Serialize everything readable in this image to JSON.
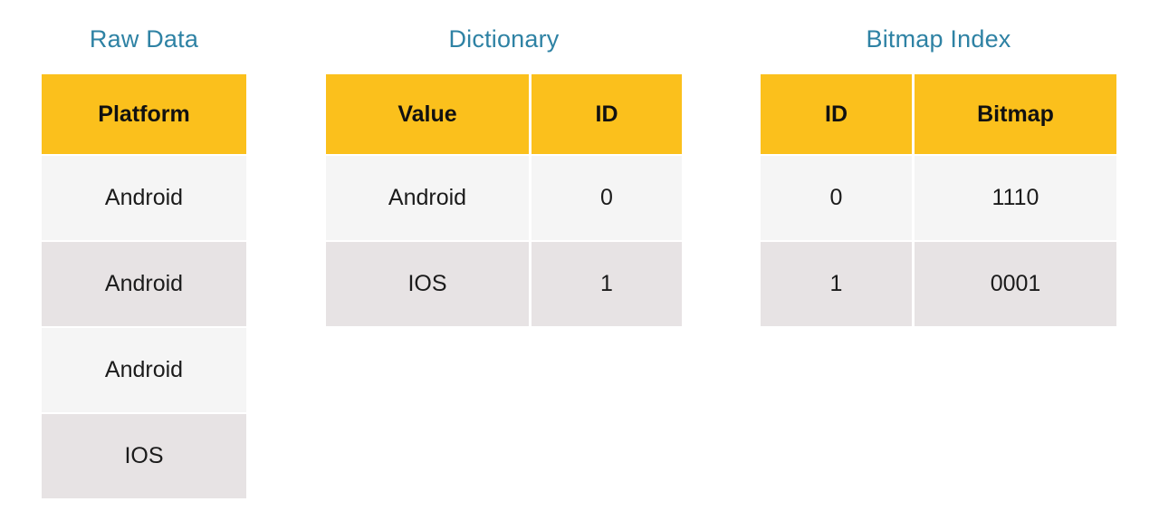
{
  "page": {
    "background_color": "#FFFFFF",
    "title_color": "#2E82A4",
    "header_color": "#FBC01C",
    "row_light_color": "#F5F5F5",
    "row_dark_color": "#E7E3E4",
    "text_color": "#1B1B1B"
  },
  "panels": {
    "raw_data": {
      "title": "Raw Data",
      "columns": [
        "Platform"
      ],
      "rows": [
        [
          "Android"
        ],
        [
          "Android"
        ],
        [
          "Android"
        ],
        [
          "IOS"
        ]
      ]
    },
    "dictionary": {
      "title": "Dictionary",
      "columns": [
        "Value",
        "ID"
      ],
      "rows": [
        [
          "Android",
          "0"
        ],
        [
          "IOS",
          "1"
        ]
      ]
    },
    "bitmap_index": {
      "title": "Bitmap Index",
      "columns": [
        "ID",
        "Bitmap"
      ],
      "rows": [
        [
          "0",
          "1110"
        ],
        [
          "1",
          "0001"
        ]
      ]
    }
  }
}
